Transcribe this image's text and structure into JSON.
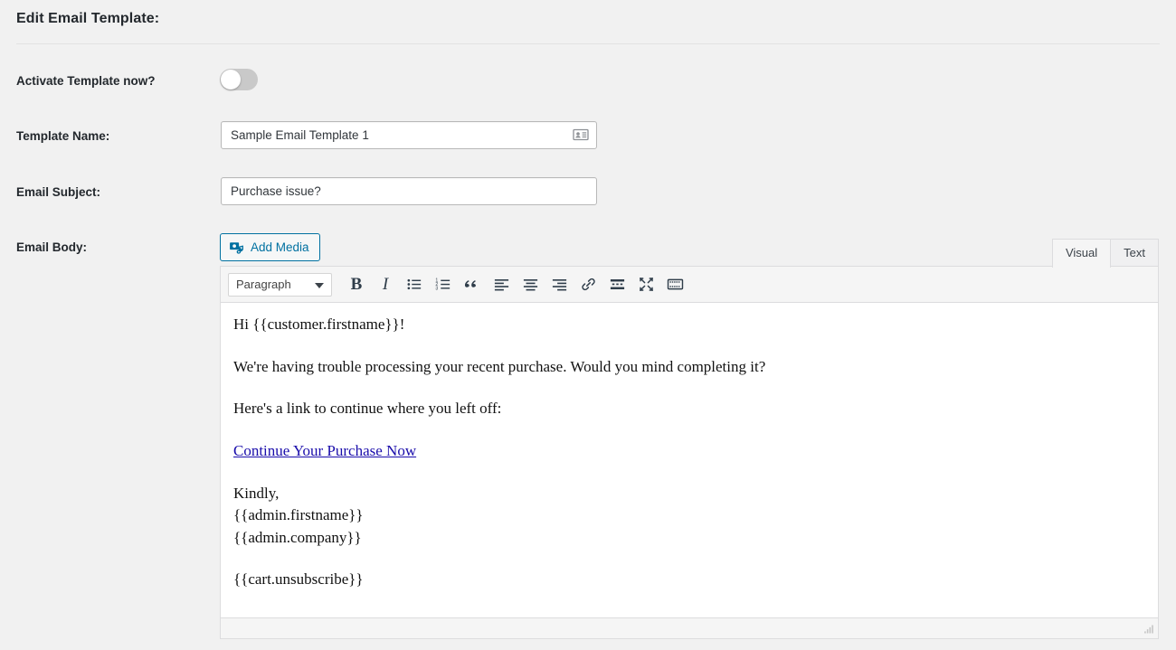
{
  "header": {
    "title": "Edit Email Template:"
  },
  "form": {
    "activate_label": "Activate Template now?",
    "activate_state": "off",
    "template_name_label": "Template Name:",
    "template_name_value": "Sample Email Template 1",
    "template_name_placeholder": "",
    "email_subject_label": "Email Subject:",
    "email_subject_value": "Purchase issue?",
    "email_subject_placeholder": "",
    "email_body_label": "Email Body:"
  },
  "editor": {
    "add_media_label": "Add Media",
    "tabs": [
      {
        "label": "Visual",
        "active": true
      },
      {
        "label": "Text",
        "active": false
      }
    ],
    "format_select_value": "Paragraph",
    "toolbar_buttons": [
      {
        "name": "bold",
        "label": "B"
      },
      {
        "name": "italic",
        "label": "I"
      },
      {
        "name": "bulleted-list",
        "label": ""
      },
      {
        "name": "numbered-list",
        "label": ""
      },
      {
        "name": "blockquote",
        "label": ""
      },
      {
        "name": "align-left",
        "label": ""
      },
      {
        "name": "align-center",
        "label": ""
      },
      {
        "name": "align-right",
        "label": ""
      },
      {
        "name": "insert-link",
        "label": ""
      },
      {
        "name": "read-more",
        "label": ""
      },
      {
        "name": "distraction-free",
        "label": ""
      },
      {
        "name": "toolbar-toggle",
        "label": ""
      }
    ],
    "body": {
      "line1": "Hi {{customer.firstname}}!",
      "line2": "We're having trouble processing your recent purchase. Would you mind completing it?",
      "line3": "Here's a link to continue where you left off:",
      "link_text": "Continue Your Purchase Now",
      "sign1": "Kindly,",
      "sign2": "{{admin.firstname}}",
      "sign3": "{{admin.company}}",
      "sign4": "{{cart.unsubscribe}}"
    }
  },
  "colors": {
    "page_background": "#f1f1f1",
    "accent_blue": "#0071a1",
    "link_blue": "#1a0dab",
    "toggle_off": "#c9c9c9",
    "text_dark": "#23282d"
  }
}
